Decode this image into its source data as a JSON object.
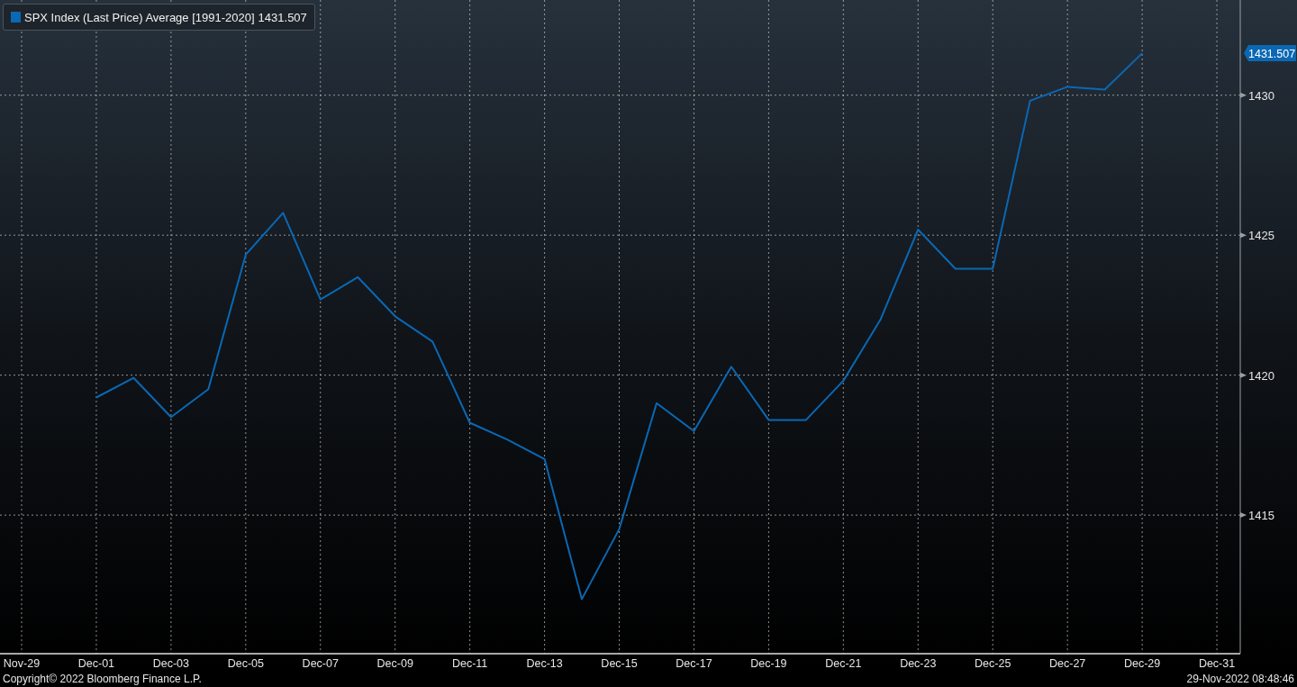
{
  "legend": {
    "value": "1431.507",
    "color": "#0a68b4"
  },
  "chart": {
    "last_value_tag": "1431.507",
    "chart_data": {
      "type": "line",
      "categories": [
        "Nov-29",
        null,
        "Dec-01",
        null,
        "Dec-03",
        null,
        "Dec-05",
        null,
        "Dec-07",
        null,
        "Dec-09",
        null,
        "Dec-11",
        null,
        "Dec-13",
        null,
        "Dec-15",
        null,
        "Dec-17",
        null,
        "Dec-19",
        null,
        "Dec-21",
        null,
        "Dec-23",
        null,
        "Dec-25",
        null,
        "Dec-27",
        null,
        "Dec-29",
        null,
        "Dec-31"
      ],
      "series": [
        {
          "name": "SPX Index (Last Price) Average [1991-2020]",
          "color": "#0a68b4",
          "values": [
            null,
            null,
            1419.2,
            1419.9,
            1418.5,
            1419.5,
            1424.3,
            1425.8,
            1422.7,
            1423.5,
            1422.1,
            1421.2,
            1418.3,
            1417.7,
            1417.0,
            1412.0,
            1414.5,
            1419.0,
            1418.0,
            1420.3,
            1418.4,
            1418.4,
            1419.8,
            1422.0,
            1425.2,
            1423.8,
            1423.8,
            1429.8,
            1430.3,
            1430.2,
            1431.5,
            null,
            null
          ]
        }
      ],
      "ylim": [
        1410.05,
        1433.4
      ],
      "yticks": [
        1415,
        1420,
        1425,
        1430
      ],
      "grid": true
    }
  },
  "footer": {
    "copyright": "Copyright© 2022 Bloomberg Finance L.P.",
    "timestamp": "29-Nov-2022 08:48:46"
  }
}
